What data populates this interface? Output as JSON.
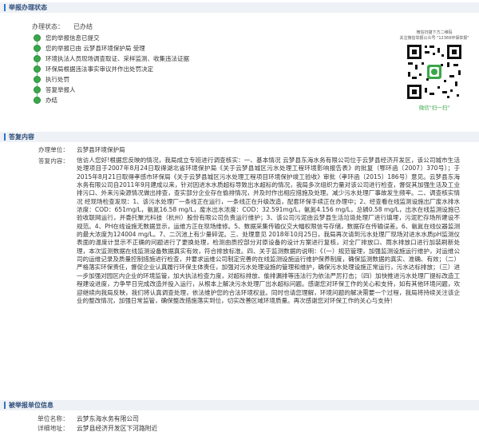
{
  "sections": {
    "status": "举报办理状态",
    "reply": "答复内容",
    "reporter": "被举报单位信息"
  },
  "status": {
    "label": "办理状态：",
    "value": "已办结",
    "steps": [
      "您的举报信息已提交",
      "您的举报已由 云梦县环境保护局 受理",
      "环境执法人员现场调查取证、采样监测、收集违法证据",
      "环保局根据违法事实审议并作出处罚决定",
      "执行处罚",
      "答复举报人",
      "办结"
    ]
  },
  "qr": {
    "line1": "微信扫描下方二维码",
    "line2": "关注微信举报公众号 \"12369环保举报\"",
    "caption": "微信\"扫一扫\""
  },
  "reply": {
    "unit_label": "办理单位：",
    "unit_value": "云梦县环境保护局",
    "content_label": "答复内容：",
    "content": "信访人您好!根据您反映的情况，我局成立专班进行调查核实：一、基本情况 云梦县东海水务有限公司位于云梦县经济开发区，该公司城市生活处理项目于2007年8月24日取得湖北省环境保护局《关于云梦县城区污水处理工程环境影响报告表》的批复（鄂环函〔2007〕370号）；于2015年8月21日取得孝感市环保局《关于云梦县城区污水处理工程项目环境保护竣工验收》审批（孝环函〔2015〕186号）意见。云梦县东海水务有限公司自2011年9月建成以来，针对因进水水质超标导致出水超标的情况，我局多次组织力量对该公司进行检查，督促其加强生活及工业排污口、外来污染源情况做出排查，查实部分企业存在偷排情况，并及时作出相应措施及处理。减少污水处理厂事故发生频率。二、调查核实情况 经现场检查发现：1、该污水处理厂一条线正在运行，一条线正在升级改造，配套环保手续正在办理中；2、经查看在线监测设施出厂废水排水浓度：COD：651mg/L，氨氮16.58 mg/L，废水出水浓度：COD：32.591mg/L，氨氮4.156 mg/L，总磷0.58 mg/L，出水在线监测设施已验收联网运行，并委托聚光科技（杭州）股份有限公司负责运行维护；3、该公司污泥由云梦县生活垃圾处理厂进行填埋，污泥贮存场所建设不规范。4、PH在线设施无数据显示，运维方正在现场维修。5、数据采集传输仪交大幅权限信号存储，数据存在传输误差。6、氨氮在线仪器监测的最大浓度为124004 mg/L。7、二沉池上有少量碎泥。三、处理意见 2018年10月25日，我局再次请到污水处理厂现场对进水水质pH监测仪表面的温度计显示不正确的问题进行了更换处理，检测由质控部分对原设备的设计方案进行复核，对全厂排放口、雨水排放口进行加装刷新处理，本次监测数据在线监测设备数据真实有效，符合排放标准。四、关于监测数据的说明：《（一）规范管理，加强监测设施运行维护，对运维公司的运维记录及质量控制措施进行检查，并要求运维公司制定完善的在线监测设施运行维护保养制度，确保监测数据的真实、准确、有效；（二）严格落实环保责任，督促企业认真履行环保主体责任，加强对污水处理设施的管理和维护，确保污水处理设施正常运行，污水达标排放；（三）进一步加强对园区内企业的环境监管，加大执法检查力度，对超标排放、偷排漏排等违法行为依法严厉打击；（四）加快推进污水处理厂提标改造工程建设进度，力争早日完成改造并投入运行，从根本上解决污水处理厂出水超标问题。感谢您对环保工作的关心和支持，如有其他环境问题，欢迎继续向我局反映，我们将认真调查处理，依法维护您的合法环境权益。同时也请您理解，环境问题的解决需要一个过程，我局将持续关注该企业的整改情况，加强日常监管，确保整改措施落实到位，切实改善区域环境质量。再次感谢您对环保工作的关心与支持！"
  },
  "reporter": {
    "unit_label": "单位名称：",
    "unit_value": "云梦东海水务有限公司",
    "addr_label": "详细地址：",
    "addr_value": "云梦县经济开发区下河路附近"
  }
}
